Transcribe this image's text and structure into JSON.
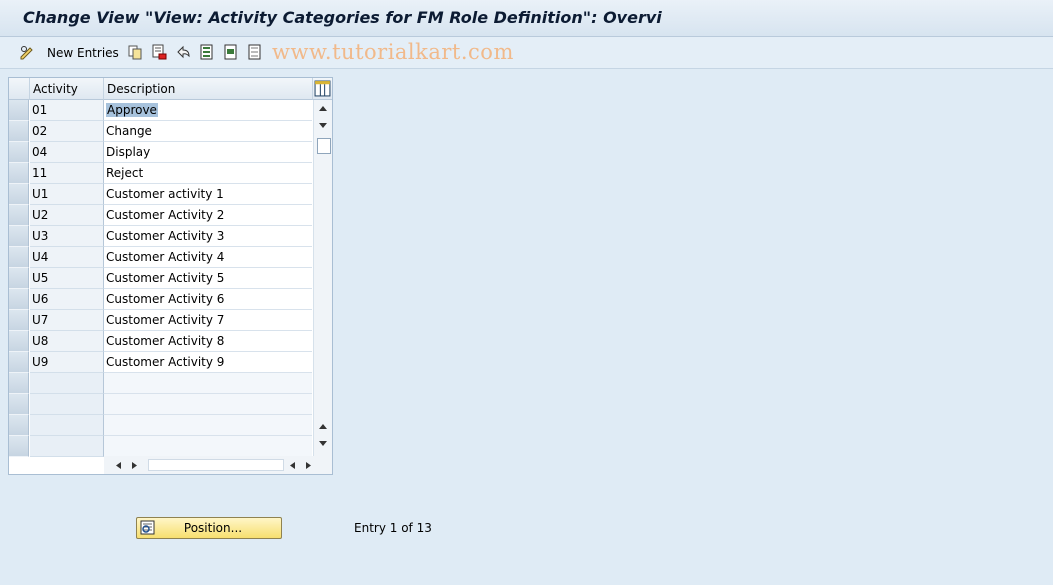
{
  "window": {
    "title": "Change View \"View: Activity Categories for FM Role Definition\": Overvi"
  },
  "toolbar": {
    "new_entries_label": "New Entries",
    "icons": [
      "pencil-glasses-icon",
      "copy-icon",
      "delete-icon",
      "undo-icon",
      "select-all-icon",
      "select-block-icon",
      "deselect-all-icon"
    ]
  },
  "watermark": "www.tutorialkart.com",
  "table": {
    "columns": [
      "Activity",
      "Description"
    ],
    "rows": [
      {
        "activity": "01",
        "description": "Approve"
      },
      {
        "activity": "02",
        "description": "Change"
      },
      {
        "activity": "04",
        "description": "Display"
      },
      {
        "activity": "11",
        "description": "Reject"
      },
      {
        "activity": "U1",
        "description": "Customer activity 1"
      },
      {
        "activity": "U2",
        "description": "Customer Activity 2"
      },
      {
        "activity": "U3",
        "description": "Customer Activity 3"
      },
      {
        "activity": "U4",
        "description": "Customer Activity 4"
      },
      {
        "activity": "U5",
        "description": "Customer Activity 5"
      },
      {
        "activity": "U6",
        "description": "Customer Activity 6"
      },
      {
        "activity": "U7",
        "description": "Customer Activity 7"
      },
      {
        "activity": "U8",
        "description": "Customer Activity 8"
      },
      {
        "activity": "U9",
        "description": "Customer Activity 9"
      }
    ],
    "selected_row": 0,
    "empty_rows": 4
  },
  "footer": {
    "position_button_label": "Position...",
    "entry_text": "Entry 1 of 13"
  },
  "colors": {
    "background": "#dfebf5",
    "selection": "#a7c2dc",
    "button": "#f7df6f"
  }
}
